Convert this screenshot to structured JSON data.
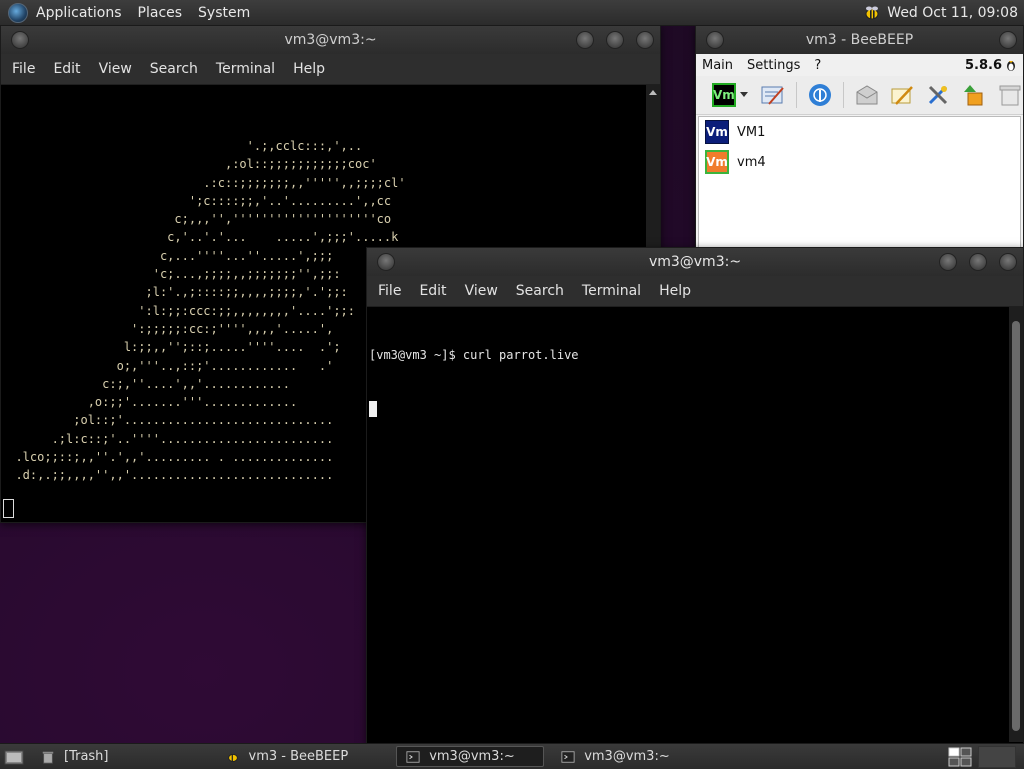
{
  "top_panel": {
    "menus": [
      "Applications",
      "Places",
      "System"
    ],
    "clock": "Wed Oct 11, 09:08"
  },
  "term_back": {
    "title": "vm3@vm3:~",
    "menu": [
      "File",
      "Edit",
      "View",
      "Search",
      "Terminal",
      "Help"
    ],
    "lines": [
      "                                  '.;,cclc:::,',..",
      "                               ,:ol::;;;;;;;;;;;coc'",
      "                            .:c::;;;;;;;,,''''',,;;;;cl'",
      "                          ';c::::;;,'..'.........',,cc",
      "                        c;,,,'',''''''''''''''''''''co",
      "                       c,'..'.'...    .....',;;;'.....k",
      "                      c,...''''...''.....',;;;",
      "                     'c;...,;;;;,,;;;;;;;'',;;:",
      "                    ;l:'.,;::::;;,,,,;;;;,'.';;:",
      "                   ':l:;;:ccc:;;,,,,,,,,'....';;:",
      "                  ':;;;;;:cc:;'''',,,,'.....',",
      "                 l:;;,,'';::;.....''''....  .';",
      "                o;,'''..,::;'............   .'",
      "              c:;,''....',,'............",
      "            ,o:;;'.......'''.............",
      "          ;ol::;'.............................",
      "       .;l:c::;'..''''........................",
      "  .lco;;::;,,''.',,'......... . ..............",
      "  .d:,.;;,,,,'',,'............................"
    ]
  },
  "beebeep": {
    "title": "vm3 - BeeBEEP",
    "menu": [
      "Main",
      "Settings",
      "?"
    ],
    "version": "5.8.6",
    "toolbar_badge": "Vm",
    "users": [
      {
        "badge": "Vm",
        "name": "VM1",
        "color": "#0b1e7a"
      },
      {
        "badge": "Vm",
        "name": "vm4",
        "color": "#f07c2c"
      }
    ]
  },
  "term_front": {
    "title": "vm3@vm3:~",
    "menu": [
      "File",
      "Edit",
      "View",
      "Search",
      "Terminal",
      "Help"
    ],
    "prompt": "[vm3@vm3 ~]$ curl parrot.live"
  },
  "taskbar": {
    "items": [
      "[Trash]",
      "vm3 - BeeBEEP",
      "vm3@vm3:~",
      "vm3@vm3:~"
    ]
  }
}
